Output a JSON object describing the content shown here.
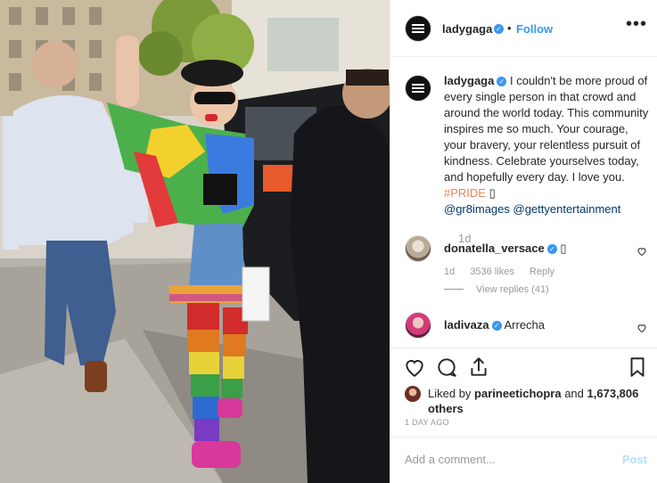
{
  "post": {
    "username": "ladygaga",
    "follow_label": "Follow",
    "dot": "•",
    "more_label": "•••"
  },
  "caption": {
    "username": "ladygaga",
    "text": "I couldn't be more proud of every single person in that crowd and around the world today. This community inspires me so much. Your courage, your bravery, your relentless pursuit of kindness. Celebrate yourselves today, and hopefully every day. I love you.",
    "hashtag": "#PRIDE",
    "emoji": "▯",
    "mentions": "@gr8images @gettyentertainment",
    "time": "1d"
  },
  "comments": [
    {
      "username": "donatella_versace",
      "text": "▯",
      "time": "1d",
      "likes": "3536 likes",
      "reply_label": "Reply",
      "view_replies": "View replies (41)"
    },
    {
      "username": "ladivaza",
      "text": "Arrecha"
    }
  ],
  "likes": {
    "prefix": "Liked by",
    "user": "parineetichopra",
    "conj": "and",
    "count": "1,673,806 others"
  },
  "timestamp": "1 DAY AGO",
  "add_comment": {
    "placeholder": "Add a comment...",
    "post_label": "Post"
  },
  "colors": {
    "accent": "#3897f0",
    "hashtag": "#e8845a",
    "mention": "#003569",
    "post_disabled": "#b2dffc"
  },
  "icons": [
    "heart-icon",
    "comment-icon",
    "share-icon",
    "bookmark-icon",
    "more-icon",
    "verified-icon"
  ]
}
